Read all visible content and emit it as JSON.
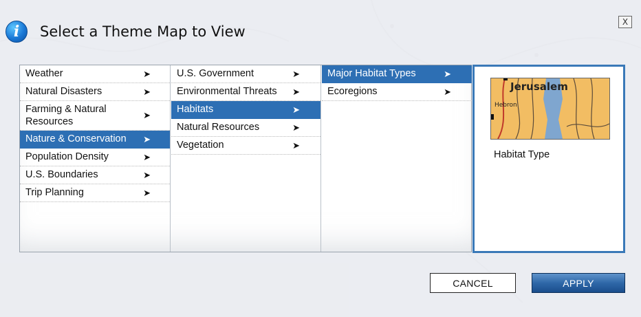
{
  "dialog": {
    "title": "Select a Theme Map to View",
    "info_icon_glyph": "i",
    "close_label": "X"
  },
  "columns": [
    {
      "items": [
        {
          "label": "Weather",
          "has_submenu": true,
          "selected": false
        },
        {
          "label": "Natural Disasters",
          "has_submenu": true,
          "selected": false
        },
        {
          "label": "Farming & Natural Resources",
          "has_submenu": true,
          "selected": false
        },
        {
          "label": "Nature & Conservation",
          "has_submenu": true,
          "selected": true
        },
        {
          "label": "Population Density",
          "has_submenu": true,
          "selected": false
        },
        {
          "label": "U.S. Boundaries",
          "has_submenu": true,
          "selected": false
        },
        {
          "label": "Trip Planning",
          "has_submenu": true,
          "selected": false
        }
      ]
    },
    {
      "items": [
        {
          "label": "U.S. Government",
          "has_submenu": true,
          "selected": false
        },
        {
          "label": "Environmental Threats",
          "has_submenu": true,
          "selected": false
        },
        {
          "label": "Habitats",
          "has_submenu": true,
          "selected": true
        },
        {
          "label": "Natural Resources",
          "has_submenu": true,
          "selected": false
        },
        {
          "label": "Vegetation",
          "has_submenu": true,
          "selected": false
        }
      ]
    },
    {
      "items": [
        {
          "label": "Major Habitat Types",
          "has_submenu": true,
          "selected": true
        },
        {
          "label": "Ecoregions",
          "has_submenu": true,
          "selected": false
        }
      ]
    }
  ],
  "arrow_glyph": "➤",
  "preview": {
    "thumb_label_city": "Jerusalem",
    "thumb_label_town": "Hebron",
    "caption": "Habitat Type"
  },
  "buttons": {
    "cancel": "CANCEL",
    "apply": "APPLY"
  },
  "colors": {
    "selection": "#2d6fb4",
    "preview_border": "#3a79b8",
    "thumb_land": "#f2bd63",
    "thumb_water": "#7fa6cf"
  }
}
